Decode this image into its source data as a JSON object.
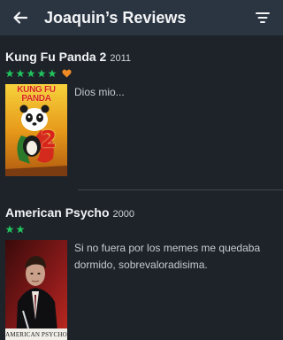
{
  "header": {
    "title": "Joaquin’s Reviews",
    "back_icon": "arrow-left-icon",
    "filter_icon": "filter-icon"
  },
  "reviews": [
    {
      "film_title": "Kung Fu Panda 2",
      "year": "2011",
      "rating_stars": 5,
      "liked": true,
      "review_text": "Dios mio...",
      "poster_title": "KUNG FU PANDA",
      "poster_number": "2"
    },
    {
      "film_title": "American Psycho",
      "year": "2000",
      "rating_stars": 2,
      "liked": false,
      "review_text": "Si no fuera por los memes me quedaba dormido, sobrevaloradisima.",
      "poster_caption": "AMERICAN PSYCHO"
    }
  ],
  "colors": {
    "header_bg": "#2b3542",
    "page_bg": "#1e2329",
    "star": "#21c25e",
    "heart": "#f08a24"
  }
}
